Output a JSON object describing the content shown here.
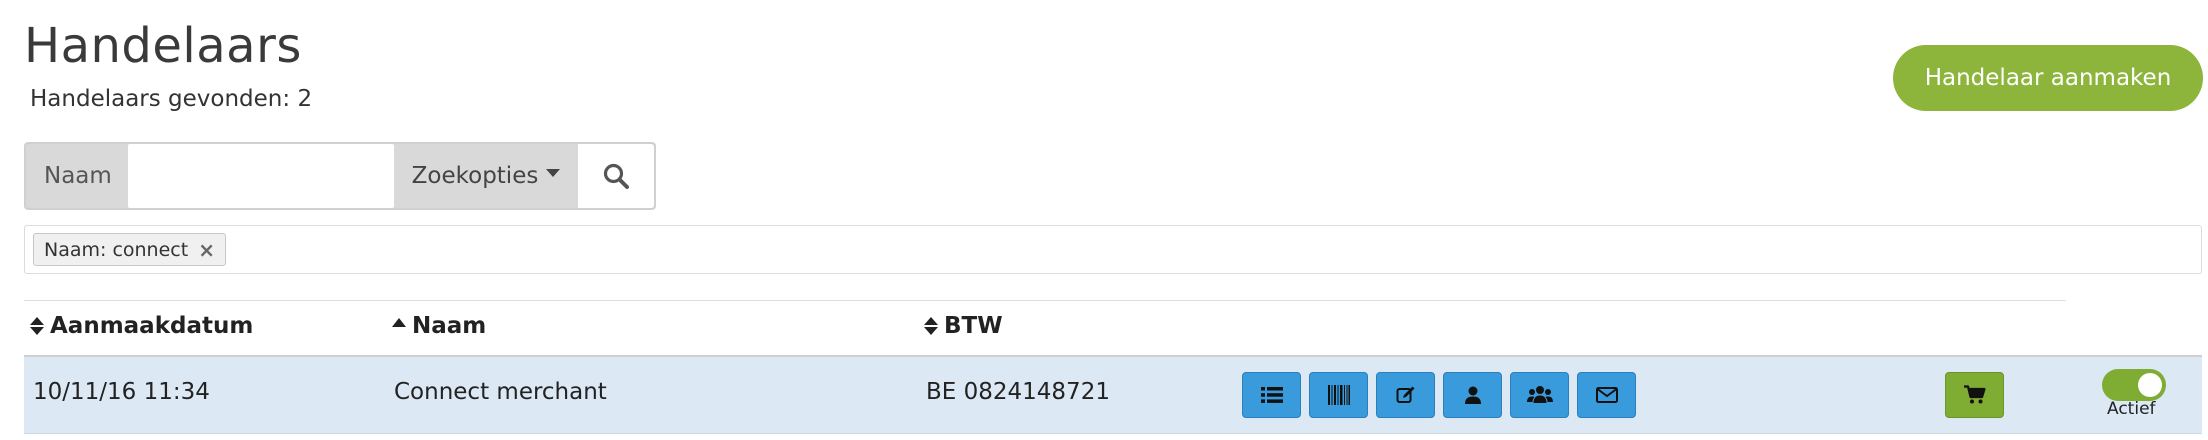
{
  "header": {
    "title": "Handelaars",
    "result_count": "Handelaars gevonden: 2",
    "create_button_label": "Handelaar aanmaken"
  },
  "search": {
    "label": "Naam",
    "value": "",
    "placeholder": "",
    "options_label": "Zoekopties"
  },
  "filters": [
    {
      "label": "Naam: connect"
    }
  ],
  "table": {
    "columns": [
      "Aanmaakdatum",
      "Naam",
      "BTW"
    ],
    "rows": [
      {
        "created": "10/11/16 11:34",
        "name": "Connect merchant",
        "vat": "BE 0824148721",
        "status_label": "Actief",
        "status_on": true
      }
    ]
  },
  "row_actions": [
    "list-icon",
    "barcode-icon",
    "edit-icon",
    "user-icon",
    "users-icon",
    "envelope-icon"
  ],
  "colors": {
    "accent_green": "#8db53b",
    "action_blue": "#3a9bdc",
    "row_highlight": "#dce9f5"
  }
}
